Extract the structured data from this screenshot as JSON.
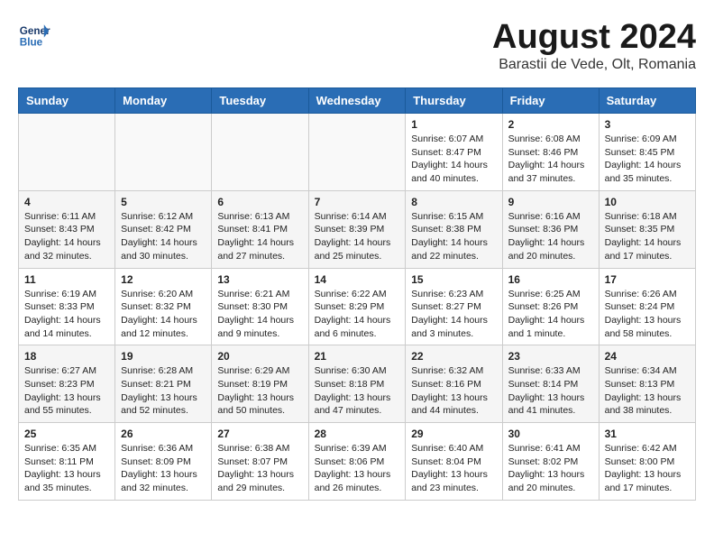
{
  "header": {
    "logo_line1": "General",
    "logo_line2": "Blue",
    "month": "August 2024",
    "location": "Barastii de Vede, Olt, Romania"
  },
  "days_of_week": [
    "Sunday",
    "Monday",
    "Tuesday",
    "Wednesday",
    "Thursday",
    "Friday",
    "Saturday"
  ],
  "weeks": [
    [
      {
        "day": "",
        "content": ""
      },
      {
        "day": "",
        "content": ""
      },
      {
        "day": "",
        "content": ""
      },
      {
        "day": "",
        "content": ""
      },
      {
        "day": "1",
        "content": "Sunrise: 6:07 AM\nSunset: 8:47 PM\nDaylight: 14 hours\nand 40 minutes."
      },
      {
        "day": "2",
        "content": "Sunrise: 6:08 AM\nSunset: 8:46 PM\nDaylight: 14 hours\nand 37 minutes."
      },
      {
        "day": "3",
        "content": "Sunrise: 6:09 AM\nSunset: 8:45 PM\nDaylight: 14 hours\nand 35 minutes."
      }
    ],
    [
      {
        "day": "4",
        "content": "Sunrise: 6:11 AM\nSunset: 8:43 PM\nDaylight: 14 hours\nand 32 minutes."
      },
      {
        "day": "5",
        "content": "Sunrise: 6:12 AM\nSunset: 8:42 PM\nDaylight: 14 hours\nand 30 minutes."
      },
      {
        "day": "6",
        "content": "Sunrise: 6:13 AM\nSunset: 8:41 PM\nDaylight: 14 hours\nand 27 minutes."
      },
      {
        "day": "7",
        "content": "Sunrise: 6:14 AM\nSunset: 8:39 PM\nDaylight: 14 hours\nand 25 minutes."
      },
      {
        "day": "8",
        "content": "Sunrise: 6:15 AM\nSunset: 8:38 PM\nDaylight: 14 hours\nand 22 minutes."
      },
      {
        "day": "9",
        "content": "Sunrise: 6:16 AM\nSunset: 8:36 PM\nDaylight: 14 hours\nand 20 minutes."
      },
      {
        "day": "10",
        "content": "Sunrise: 6:18 AM\nSunset: 8:35 PM\nDaylight: 14 hours\nand 17 minutes."
      }
    ],
    [
      {
        "day": "11",
        "content": "Sunrise: 6:19 AM\nSunset: 8:33 PM\nDaylight: 14 hours\nand 14 minutes."
      },
      {
        "day": "12",
        "content": "Sunrise: 6:20 AM\nSunset: 8:32 PM\nDaylight: 14 hours\nand 12 minutes."
      },
      {
        "day": "13",
        "content": "Sunrise: 6:21 AM\nSunset: 8:30 PM\nDaylight: 14 hours\nand 9 minutes."
      },
      {
        "day": "14",
        "content": "Sunrise: 6:22 AM\nSunset: 8:29 PM\nDaylight: 14 hours\nand 6 minutes."
      },
      {
        "day": "15",
        "content": "Sunrise: 6:23 AM\nSunset: 8:27 PM\nDaylight: 14 hours\nand 3 minutes."
      },
      {
        "day": "16",
        "content": "Sunrise: 6:25 AM\nSunset: 8:26 PM\nDaylight: 14 hours\nand 1 minute."
      },
      {
        "day": "17",
        "content": "Sunrise: 6:26 AM\nSunset: 8:24 PM\nDaylight: 13 hours\nand 58 minutes."
      }
    ],
    [
      {
        "day": "18",
        "content": "Sunrise: 6:27 AM\nSunset: 8:23 PM\nDaylight: 13 hours\nand 55 minutes."
      },
      {
        "day": "19",
        "content": "Sunrise: 6:28 AM\nSunset: 8:21 PM\nDaylight: 13 hours\nand 52 minutes."
      },
      {
        "day": "20",
        "content": "Sunrise: 6:29 AM\nSunset: 8:19 PM\nDaylight: 13 hours\nand 50 minutes."
      },
      {
        "day": "21",
        "content": "Sunrise: 6:30 AM\nSunset: 8:18 PM\nDaylight: 13 hours\nand 47 minutes."
      },
      {
        "day": "22",
        "content": "Sunrise: 6:32 AM\nSunset: 8:16 PM\nDaylight: 13 hours\nand 44 minutes."
      },
      {
        "day": "23",
        "content": "Sunrise: 6:33 AM\nSunset: 8:14 PM\nDaylight: 13 hours\nand 41 minutes."
      },
      {
        "day": "24",
        "content": "Sunrise: 6:34 AM\nSunset: 8:13 PM\nDaylight: 13 hours\nand 38 minutes."
      }
    ],
    [
      {
        "day": "25",
        "content": "Sunrise: 6:35 AM\nSunset: 8:11 PM\nDaylight: 13 hours\nand 35 minutes."
      },
      {
        "day": "26",
        "content": "Sunrise: 6:36 AM\nSunset: 8:09 PM\nDaylight: 13 hours\nand 32 minutes."
      },
      {
        "day": "27",
        "content": "Sunrise: 6:38 AM\nSunset: 8:07 PM\nDaylight: 13 hours\nand 29 minutes."
      },
      {
        "day": "28",
        "content": "Sunrise: 6:39 AM\nSunset: 8:06 PM\nDaylight: 13 hours\nand 26 minutes."
      },
      {
        "day": "29",
        "content": "Sunrise: 6:40 AM\nSunset: 8:04 PM\nDaylight: 13 hours\nand 23 minutes."
      },
      {
        "day": "30",
        "content": "Sunrise: 6:41 AM\nSunset: 8:02 PM\nDaylight: 13 hours\nand 20 minutes."
      },
      {
        "day": "31",
        "content": "Sunrise: 6:42 AM\nSunset: 8:00 PM\nDaylight: 13 hours\nand 17 minutes."
      }
    ]
  ]
}
